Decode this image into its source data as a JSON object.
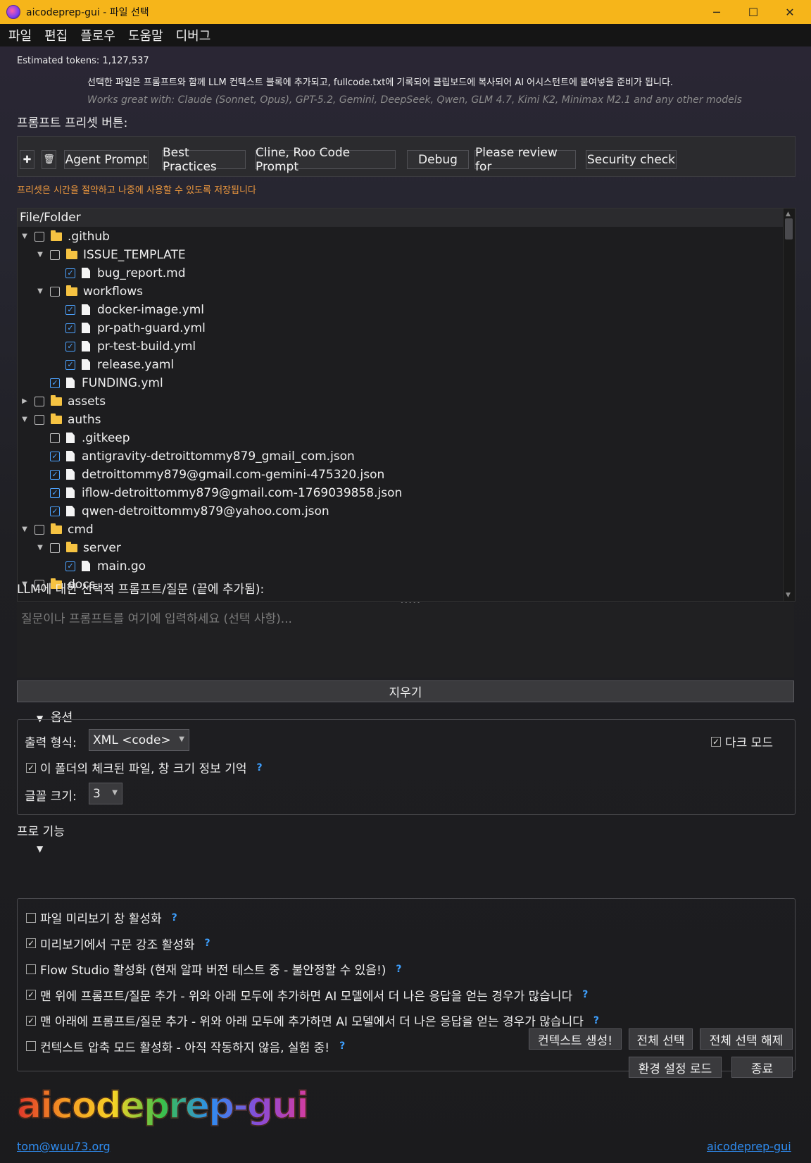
{
  "window": {
    "title": "aicodeprep-gui - 파일 선택",
    "minimize": "─",
    "maximize": "☐",
    "close": "✕"
  },
  "menu": [
    "파일",
    "편집",
    "플로우",
    "도움말",
    "디버그"
  ],
  "info": {
    "tokens": "Estimated tokens: 1,127,537",
    "description": "선택한 파일은 프롬프트와 함께 LLM 컨텍스트 블록에 추가되고, fullcode.txt에 기록되어 클립보드에 복사되어 AI 어시스턴트에 붙여넣을 준비가 됩니다.",
    "works_with": "Works great with: Claude (Sonnet, Opus), GPT-5.2, Gemini, DeepSeek, Qwen, GLM 4.7, Kimi K2, Minimax M2.1 and any other models"
  },
  "presets": {
    "label": "프롬프트 프리셋 버튼:",
    "add": "✚",
    "delete": "🗑",
    "buttons": [
      "Agent Prompt",
      "Best Practices",
      "Cline, Roo Code Prompt",
      "Debug",
      "Please review for",
      "Security check"
    ],
    "note": "프리셋은 시간을 절약하고 나중에 사용할 수 있도록 저장됩니다"
  },
  "tree": {
    "header": "File/Folder",
    "rows": [
      {
        "name": ".github",
        "type": "folder",
        "depth": 0,
        "arrow": "down",
        "checked": false
      },
      {
        "name": "ISSUE_TEMPLATE",
        "type": "folder",
        "depth": 1,
        "arrow": "down",
        "checked": false
      },
      {
        "name": "bug_report.md",
        "type": "file",
        "depth": 2,
        "arrow": "",
        "checked": true
      },
      {
        "name": "workflows",
        "type": "folder",
        "depth": 1,
        "arrow": "down",
        "checked": false
      },
      {
        "name": "docker-image.yml",
        "type": "file",
        "depth": 2,
        "arrow": "",
        "checked": true
      },
      {
        "name": "pr-path-guard.yml",
        "type": "file",
        "depth": 2,
        "arrow": "",
        "checked": true
      },
      {
        "name": "pr-test-build.yml",
        "type": "file",
        "depth": 2,
        "arrow": "",
        "checked": true
      },
      {
        "name": "release.yaml",
        "type": "file",
        "depth": 2,
        "arrow": "",
        "checked": true
      },
      {
        "name": "FUNDING.yml",
        "type": "file",
        "depth": 1,
        "arrow": "",
        "checked": true
      },
      {
        "name": "assets",
        "type": "folder",
        "depth": 0,
        "arrow": "right",
        "checked": false
      },
      {
        "name": "auths",
        "type": "folder",
        "depth": 0,
        "arrow": "down",
        "checked": false
      },
      {
        "name": ".gitkeep",
        "type": "file",
        "depth": 1,
        "arrow": "",
        "checked": false
      },
      {
        "name": "antigravity-detroittommy879_gmail_com.json",
        "type": "file",
        "depth": 1,
        "arrow": "",
        "checked": true
      },
      {
        "name": "detroittommy879@gmail.com-gemini-475320.json",
        "type": "file",
        "depth": 1,
        "arrow": "",
        "checked": true
      },
      {
        "name": "iflow-detroittommy879@gmail.com-1769039858.json",
        "type": "file",
        "depth": 1,
        "arrow": "",
        "checked": true
      },
      {
        "name": "qwen-detroittommy879@yahoo.com.json",
        "type": "file",
        "depth": 1,
        "arrow": "",
        "checked": true
      },
      {
        "name": "cmd",
        "type": "folder",
        "depth": 0,
        "arrow": "down",
        "checked": false
      },
      {
        "name": "server",
        "type": "folder",
        "depth": 1,
        "arrow": "down",
        "checked": false
      },
      {
        "name": "main.go",
        "type": "file",
        "depth": 2,
        "arrow": "",
        "checked": true
      },
      {
        "name": "docs",
        "type": "folder",
        "depth": 0,
        "arrow": "down",
        "checked": false
      }
    ]
  },
  "llm": {
    "label": "LLM에 대한 선택적 프롬프트/질문 (끝에 추가됨):",
    "placeholder": "질문이나 프롬프트를 여기에 입력하세요 (선택 사항)...",
    "clear": "지우기"
  },
  "options": {
    "title": "옵션",
    "output_format_label": "출력 형식:",
    "output_format_value": "XML <code>",
    "dark_mode_label": "다크 모드",
    "dark_mode_checked": true,
    "remember_label": "이 폴더의 체크된 파일, 창 크기 정보 기억",
    "remember_checked": true,
    "font_size_label": "글꼴 크기:",
    "font_size_value": "3"
  },
  "pro": {
    "title": "프로 기능",
    "items": [
      {
        "label": "파일 미리보기 창 활성화",
        "checked": false
      },
      {
        "label": "미리보기에서 구문 강조 활성화",
        "checked": true
      },
      {
        "label": "Flow Studio 활성화 (현재 알파 버전 테스트 중 - 불안정할 수 있음!)",
        "checked": false
      },
      {
        "label": "맨 위에 프롬프트/질문 추가 - 위와 아래 모두에 추가하면 AI 모델에서 더 나은 응답을 얻는 경우가 많습니다",
        "checked": true
      },
      {
        "label": "맨 아래에 프롬프트/질문 추가 - 위와 아래 모두에 추가하면 AI 모델에서 더 나은 응답을 얻는 경우가 많습니다",
        "checked": true
      },
      {
        "label": "컨텍스트 압축 모드 활성화 - 아직 작동하지 않음, 실험 중!",
        "checked": false
      }
    ]
  },
  "actions": {
    "generate": "컨텍스트 생성!",
    "select_all": "전체 선택",
    "deselect_all": "전체 선택 해제",
    "load_prefs": "환경 설정 로드",
    "quit": "종료"
  },
  "footer": {
    "logo": "aicodeprep-gui",
    "email": "tom@wuu73.org",
    "site": "aicodeprep-gui"
  },
  "help_mark": "?",
  "colors": {
    "titlebar": "#f6b51a",
    "link": "#2f8cf0",
    "note": "#f09a3e",
    "check": "#4da3ff"
  }
}
